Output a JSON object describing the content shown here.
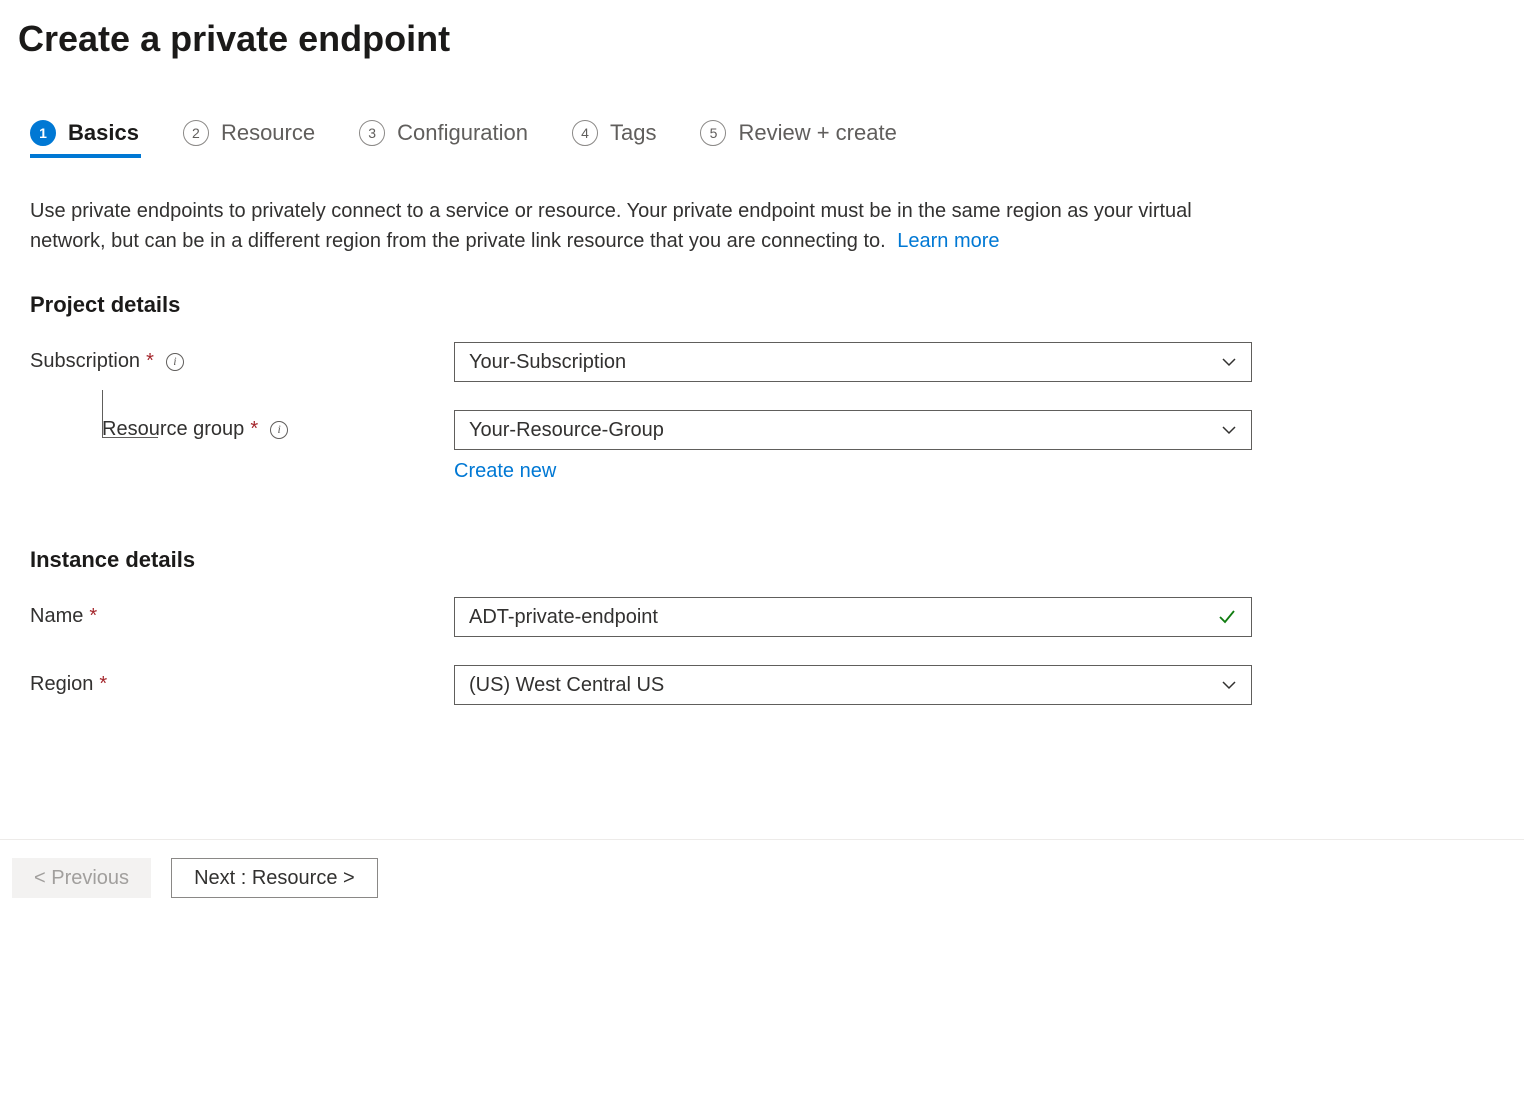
{
  "header": {
    "title": "Create a private endpoint"
  },
  "tabs": [
    {
      "num": "1",
      "label": "Basics",
      "active": true
    },
    {
      "num": "2",
      "label": "Resource",
      "active": false
    },
    {
      "num": "3",
      "label": "Configuration",
      "active": false
    },
    {
      "num": "4",
      "label": "Tags",
      "active": false
    },
    {
      "num": "5",
      "label": "Review + create",
      "active": false
    }
  ],
  "description": {
    "text": "Use private endpoints to privately connect to a service or resource. Your private endpoint must be in the same region as your virtual network, but can be in a different region from the private link resource that you are connecting to.",
    "learn_more": "Learn more"
  },
  "sections": {
    "project_details": {
      "title": "Project details",
      "subscription": {
        "label": "Subscription",
        "value": "Your-Subscription"
      },
      "resource_group": {
        "label": "Resource group",
        "value": "Your-Resource-Group",
        "create_new": "Create new"
      }
    },
    "instance_details": {
      "title": "Instance details",
      "name": {
        "label": "Name",
        "value": "ADT-private-endpoint"
      },
      "region": {
        "label": "Region",
        "value": "(US) West Central US"
      }
    }
  },
  "footer": {
    "previous": "< Previous",
    "next": "Next : Resource >"
  }
}
